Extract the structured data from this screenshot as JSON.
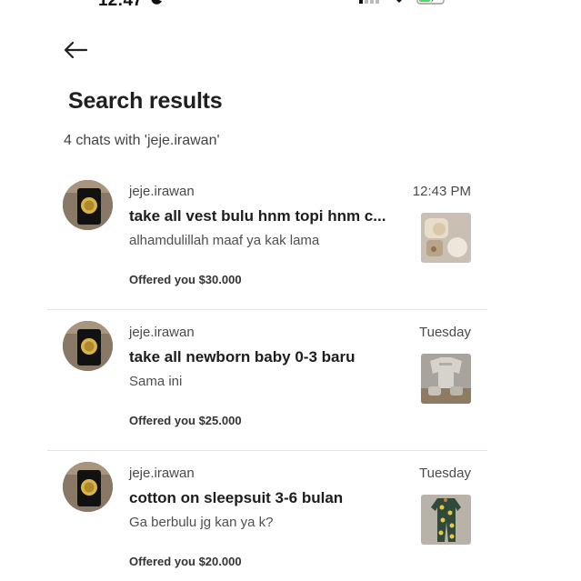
{
  "status_bar": {
    "time": "12:47"
  },
  "header": {
    "title": "Search results",
    "results_count": "4 chats with 'jeje.irawan'"
  },
  "chats": [
    {
      "username": "jeje.irawan",
      "time": "12:43 PM",
      "title": "take all vest bulu hnm topi hnm c...",
      "last_message": "alhamdulillah maaf ya kak lama",
      "offer": "Offered you $30.000"
    },
    {
      "username": "jeje.irawan",
      "time": "Tuesday",
      "title": "take all newborn baby 0-3 baru",
      "last_message": "Sama ini",
      "offer": "Offered you $25.000"
    },
    {
      "username": "jeje.irawan",
      "time": "Tuesday",
      "title": "cotton on sleepsuit 3-6 bulan",
      "last_message": "Ga berbulu jg kan ya k?",
      "offer": "Offered you $20.000"
    }
  ],
  "icons": {
    "back": "arrow-left-icon",
    "moon": "moon-icon",
    "signal": "signal-icon",
    "wifi": "wifi-icon",
    "battery": "battery-charging-icon"
  },
  "colors": {
    "battery_fill": "#4cd964",
    "divider": "#e3e3e3"
  }
}
